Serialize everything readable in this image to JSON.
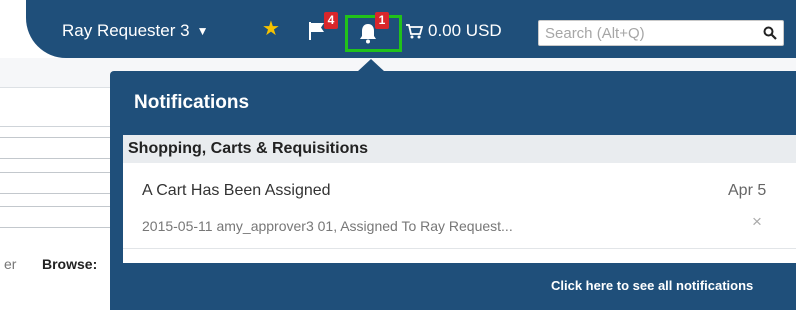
{
  "header": {
    "user_name": "Ray Requester 3",
    "caret_icon": "caret-down-icon",
    "favorites_icon": "star-icon",
    "flag_icon": "flag-icon",
    "flag_count": "4",
    "bell_icon": "bell-icon",
    "bell_count": "1",
    "cart_icon": "cart-icon",
    "cart_total": "0.00 USD",
    "search": {
      "placeholder": "Search (Alt+Q)",
      "value": "",
      "icon": "search-icon"
    },
    "colors": {
      "nav": "#1f4f7a",
      "badge": "#d9262b",
      "highlight": "#21c21a",
      "star": "#f5c200"
    }
  },
  "background": {
    "fragment": "er",
    "browse_label": "Browse:"
  },
  "notifications": {
    "title": "Notifications",
    "category": "Shopping, Carts & Requisitions",
    "items": [
      {
        "title": "A Cart Has Been Assigned",
        "date": "Apr 5",
        "detail": "2015-05-11 amy_approver3 01, Assigned To Ray Request...",
        "dismiss": "×"
      }
    ],
    "see_all": "Click here to see all notifications"
  }
}
